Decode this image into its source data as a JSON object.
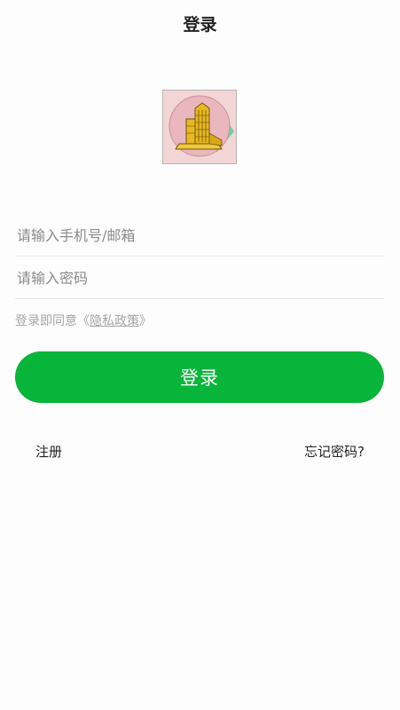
{
  "header": {
    "title": "登录"
  },
  "logo": {
    "icon": "building-logo-icon",
    "background_color": "#f2d6d6",
    "circle_color": "#ebb7bf",
    "building_color": "#e8b820"
  },
  "form": {
    "account": {
      "placeholder": "请输入手机号/邮箱",
      "value": ""
    },
    "password": {
      "placeholder": "请输入密码",
      "value": ""
    },
    "agreement": {
      "prefix": "登录即同意",
      "open_quote": "《",
      "policy_link": "隐私政策",
      "close_quote": "》"
    },
    "submit_label": "登录"
  },
  "footer_links": {
    "register": "注册",
    "forgot_password": "忘记密码?"
  },
  "colors": {
    "primary": "#07b53a",
    "placeholder": "#8a8a8a",
    "hint": "#a5a5a5"
  }
}
